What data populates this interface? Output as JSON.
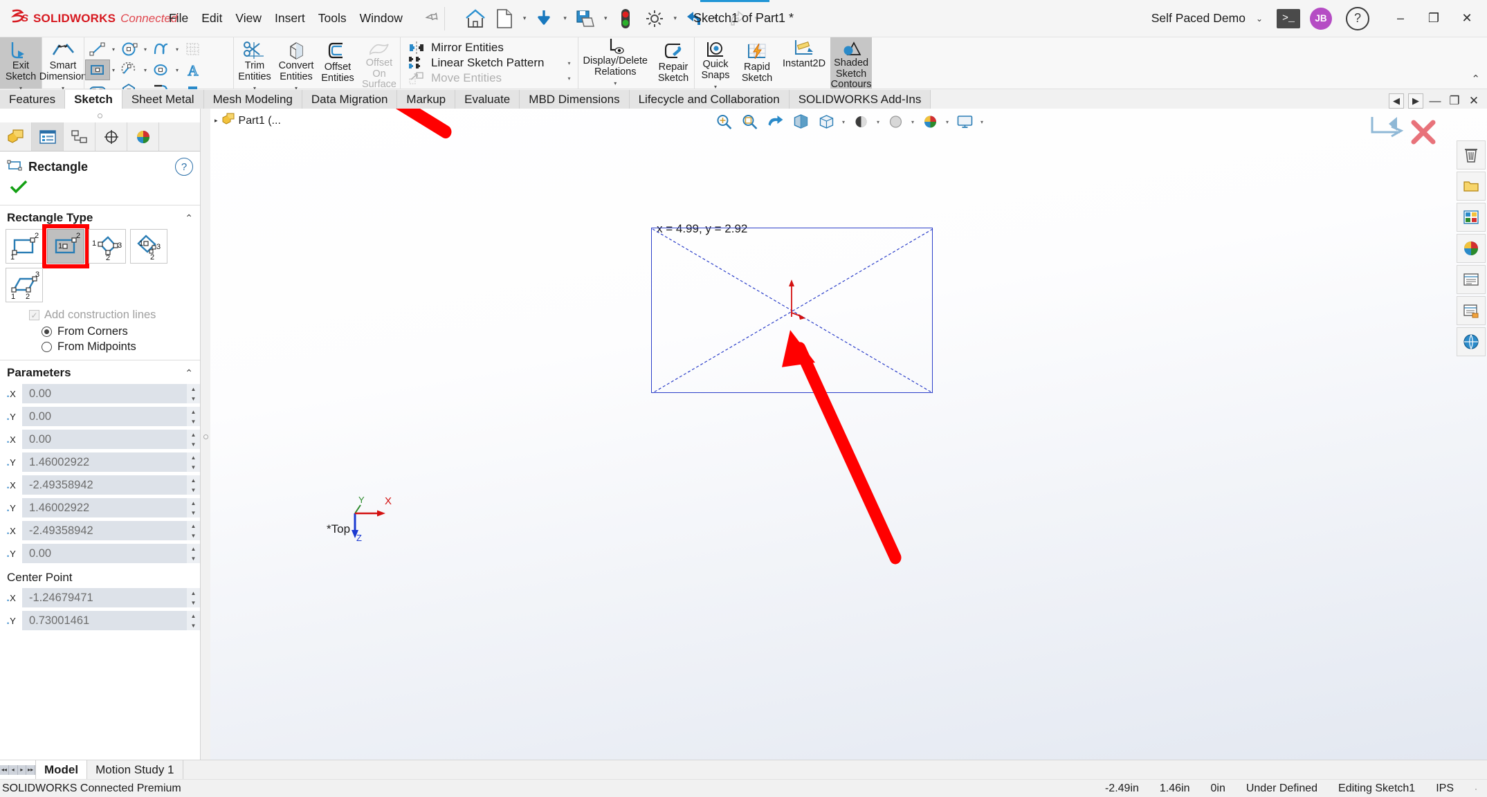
{
  "titlebar": {
    "logo_mark": "3DS",
    "brand": "SOLIDWORKS",
    "brand_suffix": "Connected",
    "menu": [
      "File",
      "Edit",
      "View",
      "Insert",
      "Tools",
      "Window"
    ],
    "pin_icon": "pin-icon",
    "quick_access": [
      {
        "name": "home-icon",
        "label": "Home"
      },
      {
        "name": "new-document-icon",
        "label": "New"
      },
      {
        "name": "open-icon",
        "label": "Open"
      },
      {
        "name": "save-icon",
        "label": "Save"
      },
      {
        "name": "traffic-light-icon",
        "label": "Rebuild"
      },
      {
        "name": "options-gear-icon",
        "label": "Options"
      },
      {
        "name": "undo-icon",
        "label": "Undo"
      },
      {
        "name": "redo-icon",
        "label": "Redo"
      }
    ],
    "document_title": "Sketch1 of Part1 *",
    "account": "Self Paced Demo",
    "avatar_initials": "JB",
    "window_minimize": "–",
    "window_restore": "❐",
    "window_close": "✕"
  },
  "ribbon": {
    "exit_sketch": "Exit\nSketch",
    "smart_dimension": "Smart\nDimension",
    "sketch_tools": [
      {
        "name": "line-tool",
        "selected": false,
        "has_dropdown": true
      },
      {
        "name": "circle-tool",
        "selected": false,
        "has_dropdown": true
      },
      {
        "name": "spline-tool",
        "selected": false,
        "has_dropdown": true
      },
      {
        "name": "surface-curve-tool",
        "selected": false,
        "has_dropdown": false
      },
      {
        "name": "rectangle-tool",
        "selected": true,
        "has_dropdown": true
      },
      {
        "name": "arc-tool",
        "selected": false,
        "has_dropdown": true
      },
      {
        "name": "ellipse-tool",
        "selected": false,
        "has_dropdown": true
      },
      {
        "name": "text-tool",
        "selected": false,
        "has_dropdown": false
      },
      {
        "name": "slot-tool",
        "selected": false,
        "has_dropdown": true
      },
      {
        "name": "polygon-tool",
        "selected": false,
        "has_dropdown": false
      },
      {
        "name": "fillet-tool",
        "selected": false,
        "has_dropdown": true
      },
      {
        "name": "plane-tool",
        "selected": false,
        "has_dropdown": false
      }
    ],
    "trim_entities": "Trim\nEntities",
    "convert_entities": "Convert\nEntities",
    "offset_entities": "Offset\nEntities",
    "offset_on_surface": "Offset\nOn\nSurface",
    "mirror_entities": "Mirror Entities",
    "linear_sketch_pattern": "Linear Sketch Pattern",
    "move_entities": "Move Entities",
    "display_delete_relations": "Display/Delete\nRelations",
    "repair_sketch": "Repair\nSketch",
    "quick_snaps": "Quick\nSnaps",
    "rapid_sketch": "Rapid\nSketch",
    "instant2d": "Instant2D",
    "shaded_sketch_contours": "Shaded\nSketch\nContours",
    "collapse_icon": "chevron-up-icon"
  },
  "tabs": {
    "items": [
      {
        "label": "Features",
        "active": false
      },
      {
        "label": "Sketch",
        "active": true
      },
      {
        "label": "Sheet Metal",
        "active": false
      },
      {
        "label": "Mesh Modeling",
        "active": false
      },
      {
        "label": "Data Migration",
        "active": false
      },
      {
        "label": "Markup",
        "active": false
      },
      {
        "label": "Evaluate",
        "active": false
      },
      {
        "label": "MBD Dimensions",
        "active": false
      },
      {
        "label": "Lifecycle and Collaboration",
        "active": false
      },
      {
        "label": "SOLIDWORKS Add-Ins",
        "active": false
      }
    ],
    "nav_prev": "◀",
    "nav_next": "▶",
    "minimize": "—",
    "restore": "❐",
    "close": "✕"
  },
  "property_manager": {
    "tabs": [
      {
        "name": "feature-manager-tab",
        "active": false
      },
      {
        "name": "property-manager-tab",
        "active": true
      },
      {
        "name": "configuration-manager-tab",
        "active": false
      },
      {
        "name": "dimxpert-manager-tab",
        "active": false
      },
      {
        "name": "display-manager-tab",
        "active": false
      }
    ],
    "title": "Rectangle",
    "help_icon": "question-mark-icon",
    "ok_icon": "green-check-icon",
    "rectangle_type": {
      "heading": "Rectangle Type",
      "collapse_icon": "chevron-up-icon",
      "options": [
        {
          "name": "corner-rectangle",
          "selected": false,
          "highlighted": false
        },
        {
          "name": "center-rectangle",
          "selected": true,
          "highlighted": true
        },
        {
          "name": "3-point-corner-rectangle",
          "selected": false,
          "highlighted": false
        },
        {
          "name": "3-point-center-rectangle",
          "selected": false,
          "highlighted": false
        },
        {
          "name": "parallelogram",
          "selected": false,
          "highlighted": false
        }
      ],
      "add_construction_lines": "Add construction lines",
      "add_construction_lines_checked": true,
      "add_construction_lines_enabled": false,
      "from_corners": "From Corners",
      "from_midpoints": "From Midpoints",
      "selected_radio": "From Corners"
    },
    "parameters": {
      "heading": "Parameters",
      "collapse_icon": "chevron-up-icon",
      "rows": [
        {
          "axis": "X",
          "value": "0.00"
        },
        {
          "axis": "Y",
          "value": "0.00"
        },
        {
          "axis": "X",
          "value": "0.00"
        },
        {
          "axis": "Y",
          "value": "1.46002922"
        },
        {
          "axis": "X",
          "value": "-2.49358942"
        },
        {
          "axis": "Y",
          "value": "1.46002922"
        },
        {
          "axis": "X",
          "value": "-2.49358942"
        },
        {
          "axis": "Y",
          "value": "0.00"
        }
      ]
    },
    "center_point": {
      "heading": "Center Point",
      "rows": [
        {
          "axis": "X",
          "value": "-1.24679471"
        },
        {
          "axis": "Y",
          "value": "0.73001461"
        }
      ]
    }
  },
  "graphics": {
    "tree_label": "Part1 (...",
    "tree_arrow": "▸",
    "view_toolbar": [
      {
        "name": "zoom-to-fit-icon"
      },
      {
        "name": "zoom-to-area-icon"
      },
      {
        "name": "previous-view-icon"
      },
      {
        "name": "section-view-icon"
      },
      {
        "name": "view-orientation-icon"
      },
      {
        "name": "display-style-icon"
      },
      {
        "name": "hide-show-items-icon"
      },
      {
        "name": "edit-appearance-icon"
      },
      {
        "name": "apply-scene-icon"
      },
      {
        "name": "view-settings-icon"
      }
    ],
    "right_dock": [
      {
        "name": "trash-icon"
      },
      {
        "name": "folder-icon"
      },
      {
        "name": "appearances-icon"
      },
      {
        "name": "color-wheel-icon"
      },
      {
        "name": "scenes-icon"
      },
      {
        "name": "decals-icon"
      },
      {
        "name": "custom-properties-icon"
      }
    ],
    "coordinate_tooltip": "x = 4.99, y = 2.92",
    "view_label": "*Top",
    "axis_x": "X",
    "axis_y": "Y",
    "axis_z": "Z",
    "confirm_corner_accept": "confirm-corner-accept-icon",
    "confirm_corner_cancel": "confirm-corner-cancel-icon"
  },
  "bottom": {
    "nav_first": "◂◂",
    "nav_prev": "◂",
    "nav_next": "▸",
    "nav_last": "▸▸",
    "tabs": [
      {
        "label": "Model",
        "active": true
      },
      {
        "label": "Motion Study 1",
        "active": false
      }
    ]
  },
  "statusbar": {
    "license": "SOLIDWORKS Connected Premium",
    "coord_x": "-2.49in",
    "coord_y": "1.46in",
    "coord_z": "0in",
    "state": "Under Defined",
    "editing": "Editing Sketch1",
    "units": "IPS",
    "overflow": "·"
  },
  "colors": {
    "brand_red": "#d71920",
    "sketch_blue": "#2b3ec9",
    "annotation_red": "#ff0000",
    "accent_blue": "#2a6fa8",
    "ok_green": "#14a014"
  }
}
